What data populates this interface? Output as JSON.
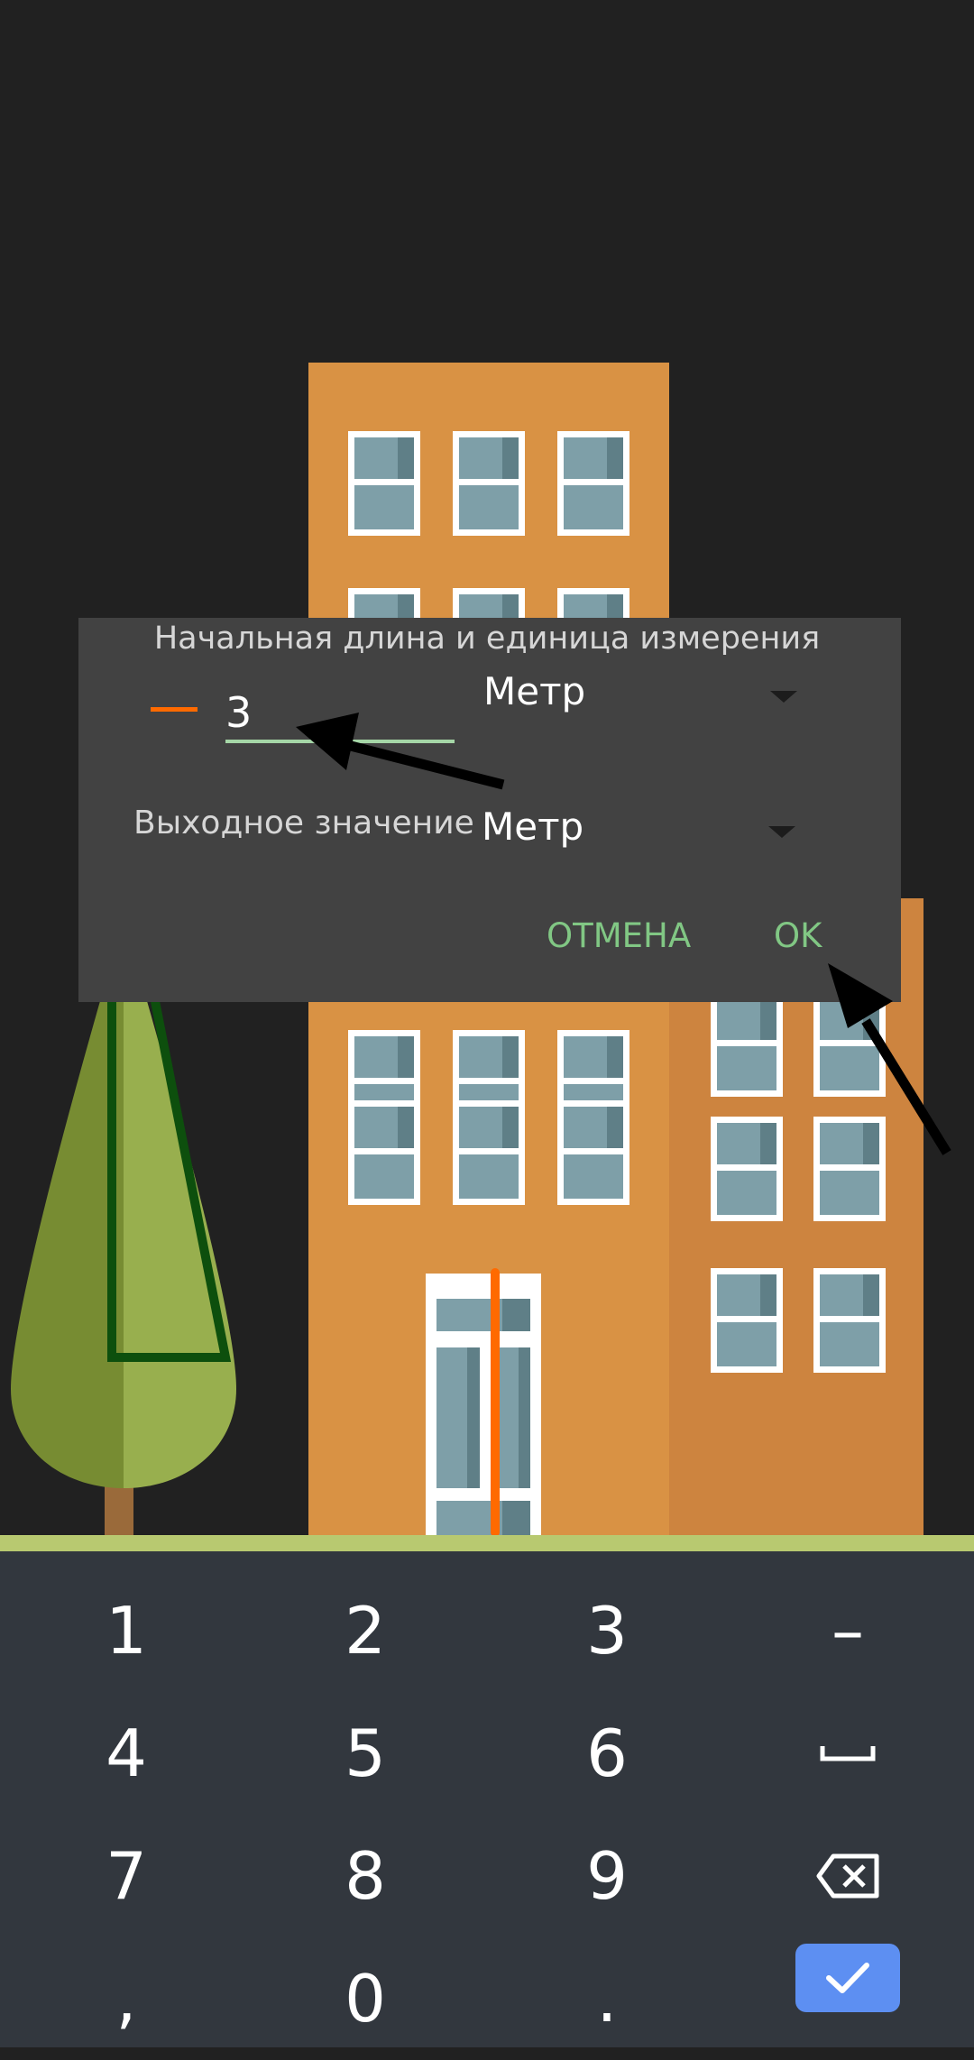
{
  "dialog": {
    "title": "Начальная длина и единица измерения",
    "length_value": "3",
    "input_unit": "Метр",
    "output_label": "Выходное значение",
    "output_unit": "Метр",
    "cancel_label": "ОТМЕНА",
    "ok_label": "OK"
  },
  "keyboard": {
    "keys": [
      "1",
      "2",
      "3",
      "–",
      "4",
      "5",
      "6",
      "␣",
      "7",
      "8",
      "9",
      "⌫",
      ",",
      "0",
      "."
    ],
    "enter_icon": "check-icon"
  },
  "colors": {
    "accent_orange": "#ff6a00",
    "accent_green": "#81c784",
    "enter_blue": "#5d8ff2"
  }
}
